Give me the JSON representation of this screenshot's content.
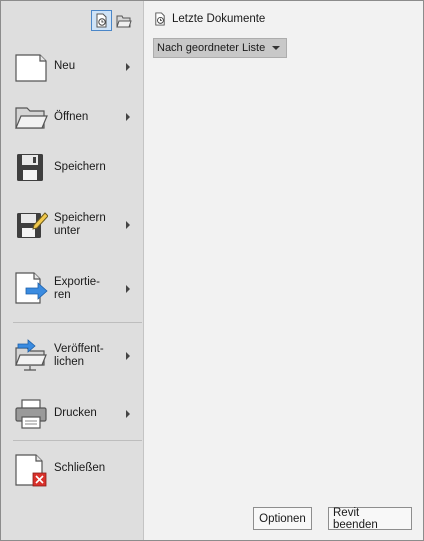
{
  "menu": {
    "items": [
      {
        "id": "new",
        "label": "Neu",
        "has_submenu": true,
        "icon": "new-document-icon"
      },
      {
        "id": "open",
        "label": "Öffnen",
        "has_submenu": true,
        "icon": "open-folder-icon"
      },
      {
        "id": "save",
        "label": "Speichern",
        "has_submenu": false,
        "icon": "save-floppy-icon"
      },
      {
        "id": "save-as",
        "label": "Speichern\nunter",
        "has_submenu": true,
        "icon": "save-as-icon"
      },
      {
        "id": "export",
        "label": "Exportie-\nren",
        "has_submenu": true,
        "icon": "export-icon"
      },
      {
        "id": "publish",
        "label": "Veröffent-\nlichen",
        "has_submenu": true,
        "icon": "publish-icon"
      },
      {
        "id": "print",
        "label": "Drucken",
        "has_submenu": true,
        "icon": "printer-icon"
      },
      {
        "id": "close",
        "label": "Schließen",
        "has_submenu": false,
        "icon": "close-document-icon"
      }
    ]
  },
  "view_toggle": {
    "recent_icon": "recent-documents-icon",
    "open_icon": "open-documents-icon",
    "active": "recent"
  },
  "recent": {
    "title": "Letzte Dokumente",
    "sort_value": "Nach geordneter Liste"
  },
  "footer": {
    "options_label": "Optionen",
    "exit_label": "Revit beenden"
  },
  "colors": {
    "panel_left": "#dedede",
    "panel_right": "#f2f2f2",
    "accent_blue": "#3a8be0",
    "close_red": "#d9312b"
  }
}
